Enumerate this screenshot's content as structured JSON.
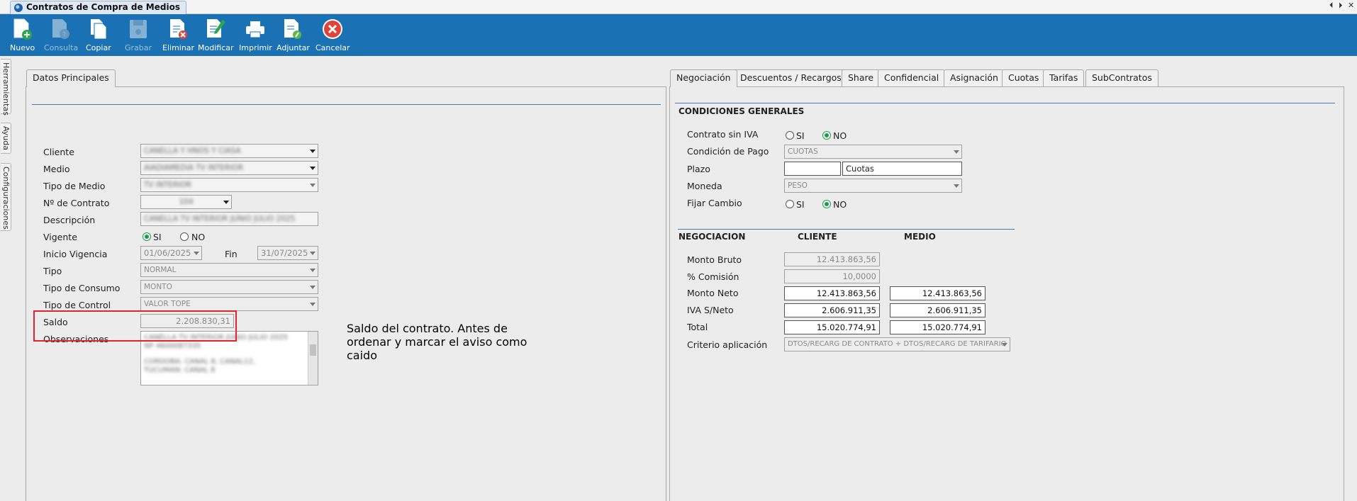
{
  "window": {
    "title": "Contratos de Compra de Medios",
    "controls": [
      "⏴",
      "⏵",
      "✕"
    ]
  },
  "toolbar": {
    "nuevo": "Nuevo",
    "consulta": "Consulta",
    "copiar": "Copiar",
    "grabar": "Grabar",
    "eliminar": "Eliminar",
    "modificar": "Modificar",
    "imprimir": "Imprimir",
    "adjuntar": "Adjuntar",
    "cancelar": "Cancelar"
  },
  "side_tabs": [
    "Herramientas",
    "Ayuda",
    "Configuraciones"
  ],
  "left_panel": {
    "tab": "Datos Principales",
    "labels": {
      "cliente": "Cliente",
      "medio": "Medio",
      "tipo_medio": "Tipo de Medio",
      "nro_contrato": "Nº de Contrato",
      "descripcion": "Descripción",
      "vigente": "Vigente",
      "inicio_vigencia": "Inicio Vigencia",
      "fin": "Fin",
      "tipo": "Tipo",
      "tipo_consumo": "Tipo de Consumo",
      "tipo_control": "Tipo de Control",
      "saldo": "Saldo",
      "observaciones": "Observaciones"
    },
    "values": {
      "cliente": "CANELLA Y HNOS Y CIASA",
      "medio": "AIADIAMEDIA TV INTERIOR",
      "tipo_medio": "TV INTERIOR",
      "nro_contrato": "104",
      "descripcion": "CANELLA TV INTERIOR JUNIO JULIO 2025",
      "vigente_si": "SI",
      "vigente_no": "NO",
      "inicio_vigencia": "01/06/2025",
      "fin": "31/07/2025",
      "tipo": "NORMAL",
      "tipo_consumo": "MONTO",
      "tipo_control": "VALOR TOPE",
      "saldo": "2.208.830,31",
      "observaciones_l1": "CANELLA TV INTERIOR JUNIO JULIO 2025",
      "observaciones_l2": "NP 4600087335",
      "observaciones_l3": "CORDOBA: CANAL 8, CANAL12,",
      "observaciones_l4": "TUCUMAN: CANAL 8"
    }
  },
  "annotation": {
    "text": "Saldo del contrato. Antes de ordenar y marcar el aviso como caido"
  },
  "right_panel": {
    "tabs": [
      "Negociación",
      "Descuentos / Recargos",
      "Share",
      "Confidencial",
      "Asignación",
      "Cuotas",
      "Tarifas",
      "SubContratos"
    ],
    "condiciones": {
      "heading": "CONDICIONES GENERALES",
      "contrato_sin_iva": "Contrato sin IVA",
      "condicion_pago": "Condición de Pago",
      "condicion_pago_value": "CUOTAS",
      "plazo": "Plazo",
      "plazo_value": "",
      "plazo_unit": "Cuotas",
      "moneda": "Moneda",
      "moneda_value": "PESO",
      "fijar_cambio": "Fijar Cambio",
      "si": "SI",
      "no": "NO"
    },
    "negociacion": {
      "heading": "NEGOCIACION",
      "col_cliente": "CLIENTE",
      "col_medio": "MEDIO",
      "monto_bruto": "Monto Bruto",
      "monto_bruto_cliente": "12.413.863,56",
      "comision": "% Comisión",
      "comision_cliente": "10,0000",
      "monto_neto": "Monto Neto",
      "monto_neto_cliente": "12.413.863,56",
      "monto_neto_medio": "12.413.863,56",
      "iva": "IVA S/Neto",
      "iva_cliente": "2.606.911,35",
      "iva_medio": "2.606.911,35",
      "total": "Total",
      "total_cliente": "15.020.774,91",
      "total_medio": "15.020.774,91",
      "criterio": "Criterio aplicación",
      "criterio_value": "DTOS/RECARG DE CONTRATO + DTOS/RECARG DE TARIFARIO"
    }
  }
}
